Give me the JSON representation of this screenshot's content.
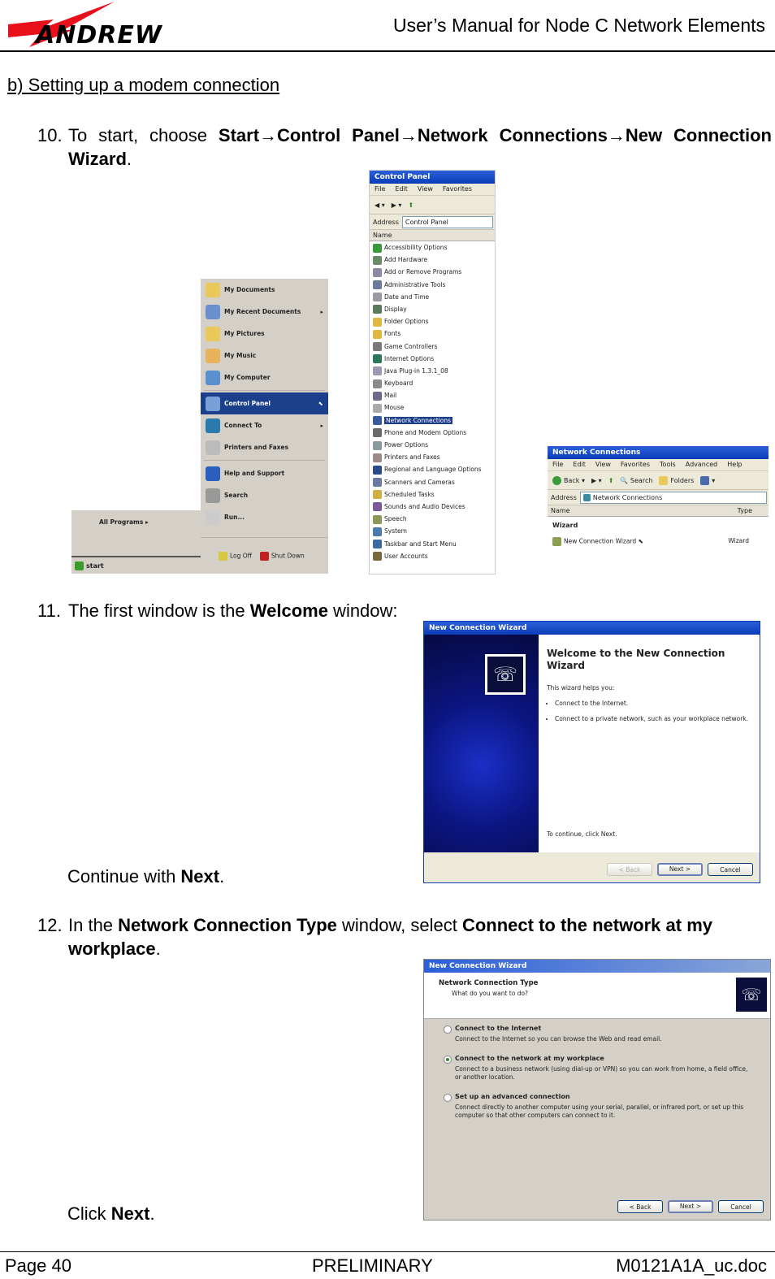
{
  "header": {
    "logo_text": "ANDREW",
    "title": "User’s Manual for Node C Network Elements"
  },
  "section_title": "b) Setting up a modem connection",
  "steps": [
    {
      "number": "10.",
      "parts": {
        "intro": "To start, choose ",
        "path_1": "Start",
        "arrow": "→",
        "path_2": "Control Panel",
        "path_3": "Network Connections",
        "path_4": "New Connection Wizard",
        "end": "."
      }
    },
    {
      "number": "11.",
      "parts": {
        "intro": "The first window is the ",
        "bold": "Welcome",
        "end": " window:"
      },
      "follow_up": {
        "prefix": "Continue with ",
        "bold": "Next",
        "end": "."
      }
    },
    {
      "number": "12.",
      "parts": {
        "intro": "In the ",
        "bold_1": "Network Connection Type",
        "mid": " window, select ",
        "bold_2": "Connect to the network at my workplace",
        "end": "."
      },
      "follow_up": {
        "prefix": "Click ",
        "bold": "Next",
        "end": "."
      }
    }
  ],
  "start_menu": {
    "items": [
      {
        "label": "My Documents",
        "icon": "folder-icon",
        "color": "#e8c95a"
      },
      {
        "label": "My Recent Documents",
        "icon": "recent-docs-icon",
        "color": "#6a8fd0",
        "submenu": "▸"
      },
      {
        "label": "My Pictures",
        "icon": "folder-icon",
        "color": "#e8c95a"
      },
      {
        "label": "My Music",
        "icon": "folder-icon",
        "color": "#e8b25a"
      },
      {
        "label": "My Computer",
        "icon": "computer-icon",
        "color": "#5a8fd0"
      },
      {
        "label": "Control Panel",
        "icon": "control-panel-icon",
        "color": "#7aa0d8",
        "selected": true
      },
      {
        "label": "Connect To",
        "icon": "globe-icon",
        "color": "#2a7ab0",
        "submenu": "▸"
      },
      {
        "label": "Printers and Faxes",
        "icon": "printer-icon",
        "color": "#bbbbbb"
      },
      {
        "label": "Help and Support",
        "icon": "help-icon",
        "color": "#2a5fc0"
      },
      {
        "label": "Search",
        "icon": "search-icon",
        "color": "#999999"
      },
      {
        "label": "Run...",
        "icon": "run-icon",
        "color": "#cccccc"
      }
    ],
    "log_off": "Log Off",
    "shut_down": "Shut Down",
    "all_programs": "All Programs",
    "start_button": "start"
  },
  "control_panel": {
    "title": "Control Panel",
    "menu": [
      "File",
      "Edit",
      "View",
      "Favorites"
    ],
    "address_label": "Address",
    "address_value": "Control Panel",
    "column_header": "Name",
    "items": [
      {
        "label": "Accessibility Options",
        "color": "#3a9a3a"
      },
      {
        "label": "Add Hardware",
        "color": "#6a8a6a"
      },
      {
        "label": "Add or Remove Programs",
        "color": "#8a8aa0"
      },
      {
        "label": "Administrative Tools",
        "color": "#6a7a9a"
      },
      {
        "label": "Date and Time",
        "color": "#9a9aa0"
      },
      {
        "label": "Display",
        "color": "#5a7a5a"
      },
      {
        "label": "Folder Options",
        "color": "#e0b840"
      },
      {
        "label": "Fonts",
        "color": "#e0b840"
      },
      {
        "label": "Game Controllers",
        "color": "#7a7a7a"
      },
      {
        "label": "Internet Options",
        "color": "#2a7a5a"
      },
      {
        "label": "Java Plug-in 1.3.1_08",
        "color": "#9a9ab0"
      },
      {
        "label": "Keyboard",
        "color": "#8a8a8a"
      },
      {
        "label": "Mail",
        "color": "#6a6a8a"
      },
      {
        "label": "Mouse",
        "color": "#aaaaaa"
      },
      {
        "label": "Network Connections",
        "color": "#3a5aa0",
        "selected": true
      },
      {
        "label": "Phone and Modem Options",
        "color": "#6a6a6a"
      },
      {
        "label": "Power Options",
        "color": "#8a9aa0"
      },
      {
        "label": "Printers and Faxes",
        "color": "#9a8a8a"
      },
      {
        "label": "Regional and Language Options",
        "color": "#2a4a8a"
      },
      {
        "label": "Scanners and Cameras",
        "color": "#6a7aa0"
      },
      {
        "label": "Scheduled Tasks",
        "color": "#d0b040"
      },
      {
        "label": "Sounds and Audio Devices",
        "color": "#7a5a9a"
      },
      {
        "label": "Speech",
        "color": "#8a9a5a"
      },
      {
        "label": "System",
        "color": "#4a7ab0"
      },
      {
        "label": "Taskbar and Start Menu",
        "color": "#3a6aa0"
      },
      {
        "label": "User Accounts",
        "color": "#7a6a3a"
      }
    ]
  },
  "network_connections": {
    "title": "Network Connections",
    "menu": [
      "File",
      "Edit",
      "View",
      "Favorites",
      "Tools",
      "Advanced",
      "Help"
    ],
    "toolbar": {
      "back": "Back",
      "search": "Search",
      "folders": "Folders"
    },
    "address_label": "Address",
    "address_value": "Network Connections",
    "columns": [
      "Name",
      "Type"
    ],
    "group": "Wizard",
    "rows": [
      {
        "name": "New Connection Wizard",
        "type": "Wizard"
      }
    ]
  },
  "wizard_welcome": {
    "title": "New Connection Wizard",
    "heading": "Welcome to the New Connection Wizard",
    "intro": "This wizard helps you:",
    "bullets": [
      "Connect to the Internet.",
      "Connect to a private network, such as your workplace network."
    ],
    "footer": "To continue, click Next.",
    "buttons": {
      "back": "< Back",
      "next": "Next >",
      "cancel": "Cancel"
    }
  },
  "wizard_type": {
    "title": "New Connection Wizard",
    "heading": "Network Connection Type",
    "subheading": "What do you want to do?",
    "options": [
      {
        "label": "Connect to the Internet",
        "description": "Connect to the Internet so you can browse the Web and read email.",
        "selected": false
      },
      {
        "label": "Connect to the network at my workplace",
        "description": "Connect to a business network (using dial-up or VPN) so you can work from home, a field office, or another location.",
        "selected": true
      },
      {
        "label": "Set up an advanced connection",
        "description": "Connect directly to another computer using your serial, parallel, or infrared port, or set up this computer so that other computers can connect to it.",
        "selected": false
      }
    ],
    "buttons": {
      "back": "< Back",
      "next": "Next >",
      "cancel": "Cancel"
    }
  },
  "footer": {
    "page": "Page 40",
    "status": "PRELIMINARY",
    "doc_id": "M0121A1A_uc.doc"
  },
  "colors": {
    "logo_red": "#e8101a",
    "xp_title_blue": "#0a3cb8",
    "selection_blue": "#1c3f8c",
    "xp_face": "#ece9d8"
  }
}
